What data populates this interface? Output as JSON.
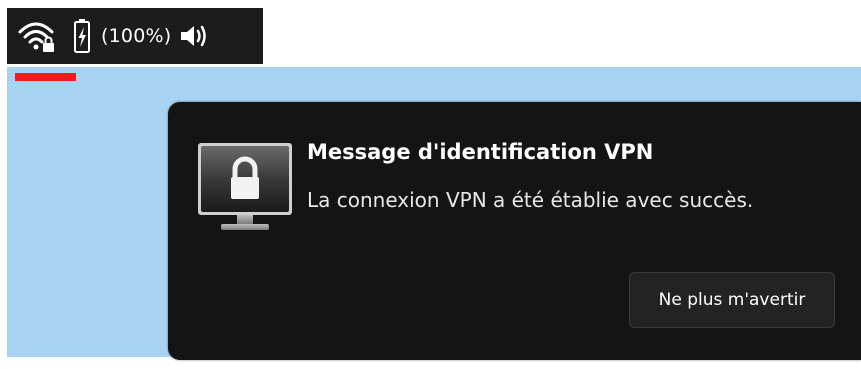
{
  "system_tray": {
    "icons": [
      "wifi-locked-icon",
      "battery-charging-icon",
      "volume-icon"
    ],
    "battery_percent_label": "(100%)"
  },
  "notification": {
    "icon": "vpn-lock-monitor-icon",
    "title": "Message d'identification VPN",
    "body": "La connexion VPN a été établie avec succès.",
    "action_button_label": "Ne plus m'avertir"
  },
  "colors": {
    "desktop_background": "#a8d2f2",
    "tray_background": "#1c1c1c",
    "notification_background": "#141414",
    "indicator": "#ee1c1c"
  }
}
